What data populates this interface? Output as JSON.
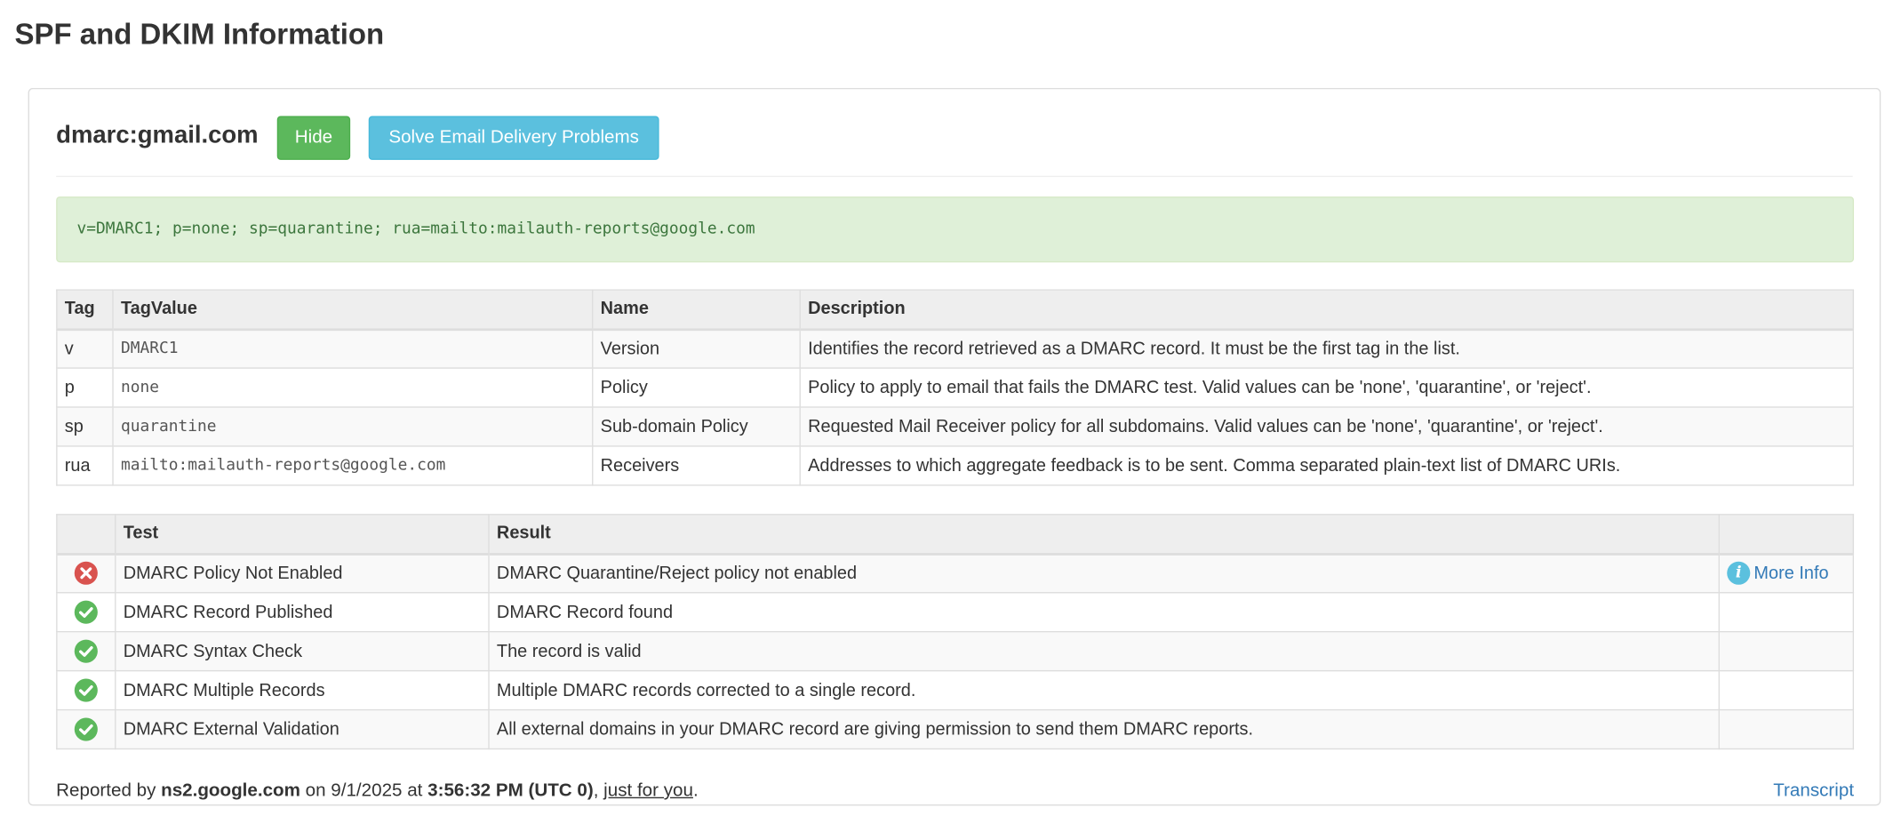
{
  "page": {
    "title": "SPF and DKIM Information"
  },
  "panel": {
    "domain": "dmarc:gmail.com",
    "hide_label": "Hide",
    "solve_label": "Solve Email Delivery Problems",
    "record": "v=DMARC1; p=none; sp=quarantine; rua=mailto:mailauth-reports@google.com"
  },
  "tag_table": {
    "headers": [
      "Tag",
      "TagValue",
      "Name",
      "Description"
    ],
    "rows": [
      {
        "tag": "v",
        "value": "DMARC1",
        "name": "Version",
        "description": "Identifies the record retrieved as a DMARC record. It must be the first tag in the list."
      },
      {
        "tag": "p",
        "value": "none",
        "name": "Policy",
        "description": "Policy to apply to email that fails the DMARC test. Valid values can be 'none', 'quarantine', or 'reject'."
      },
      {
        "tag": "sp",
        "value": "quarantine",
        "name": "Sub-domain Policy",
        "description": "Requested Mail Receiver policy for all subdomains. Valid values can be 'none', 'quarantine', or 'reject'."
      },
      {
        "tag": "rua",
        "value": "mailto:mailauth-reports@google.com",
        "name": "Receivers",
        "description": "Addresses to which aggregate feedback is to be sent. Comma separated plain-text list of DMARC URIs."
      }
    ]
  },
  "test_table": {
    "headers": [
      "",
      "Test",
      "Result",
      ""
    ],
    "rows": [
      {
        "status": "fail",
        "status_icon": "x-circle-icon",
        "test": "DMARC Policy Not Enabled",
        "result": "DMARC Quarantine/Reject policy not enabled",
        "more_info": "More Info"
      },
      {
        "status": "pass",
        "status_icon": "check-circle-icon",
        "test": "DMARC Record Published",
        "result": "DMARC Record found",
        "more_info": ""
      },
      {
        "status": "pass",
        "status_icon": "check-circle-icon",
        "test": "DMARC Syntax Check",
        "result": "The record is valid",
        "more_info": ""
      },
      {
        "status": "pass",
        "status_icon": "check-circle-icon",
        "test": "DMARC Multiple Records",
        "result": "Multiple DMARC records corrected to a single record.",
        "more_info": ""
      },
      {
        "status": "pass",
        "status_icon": "check-circle-icon",
        "test": "DMARC External Validation",
        "result": "All external domains in your DMARC record are giving permission to send them DMARC reports.",
        "more_info": ""
      }
    ]
  },
  "footer": {
    "reported_by_prefix": "Reported by ",
    "server": "ns2.google.com",
    "on_text": " on 9/1/2025 at ",
    "time": "3:56:32 PM (UTC 0)",
    "comma": ", ",
    "just_for_you": "just for you",
    "period": ".",
    "transcript": "Transcript"
  },
  "colors": {
    "pass": "#5cb85c",
    "fail": "#d9534f",
    "info": "#5bc0de",
    "link": "#337ab7",
    "record_bg": "#dff0d8"
  }
}
